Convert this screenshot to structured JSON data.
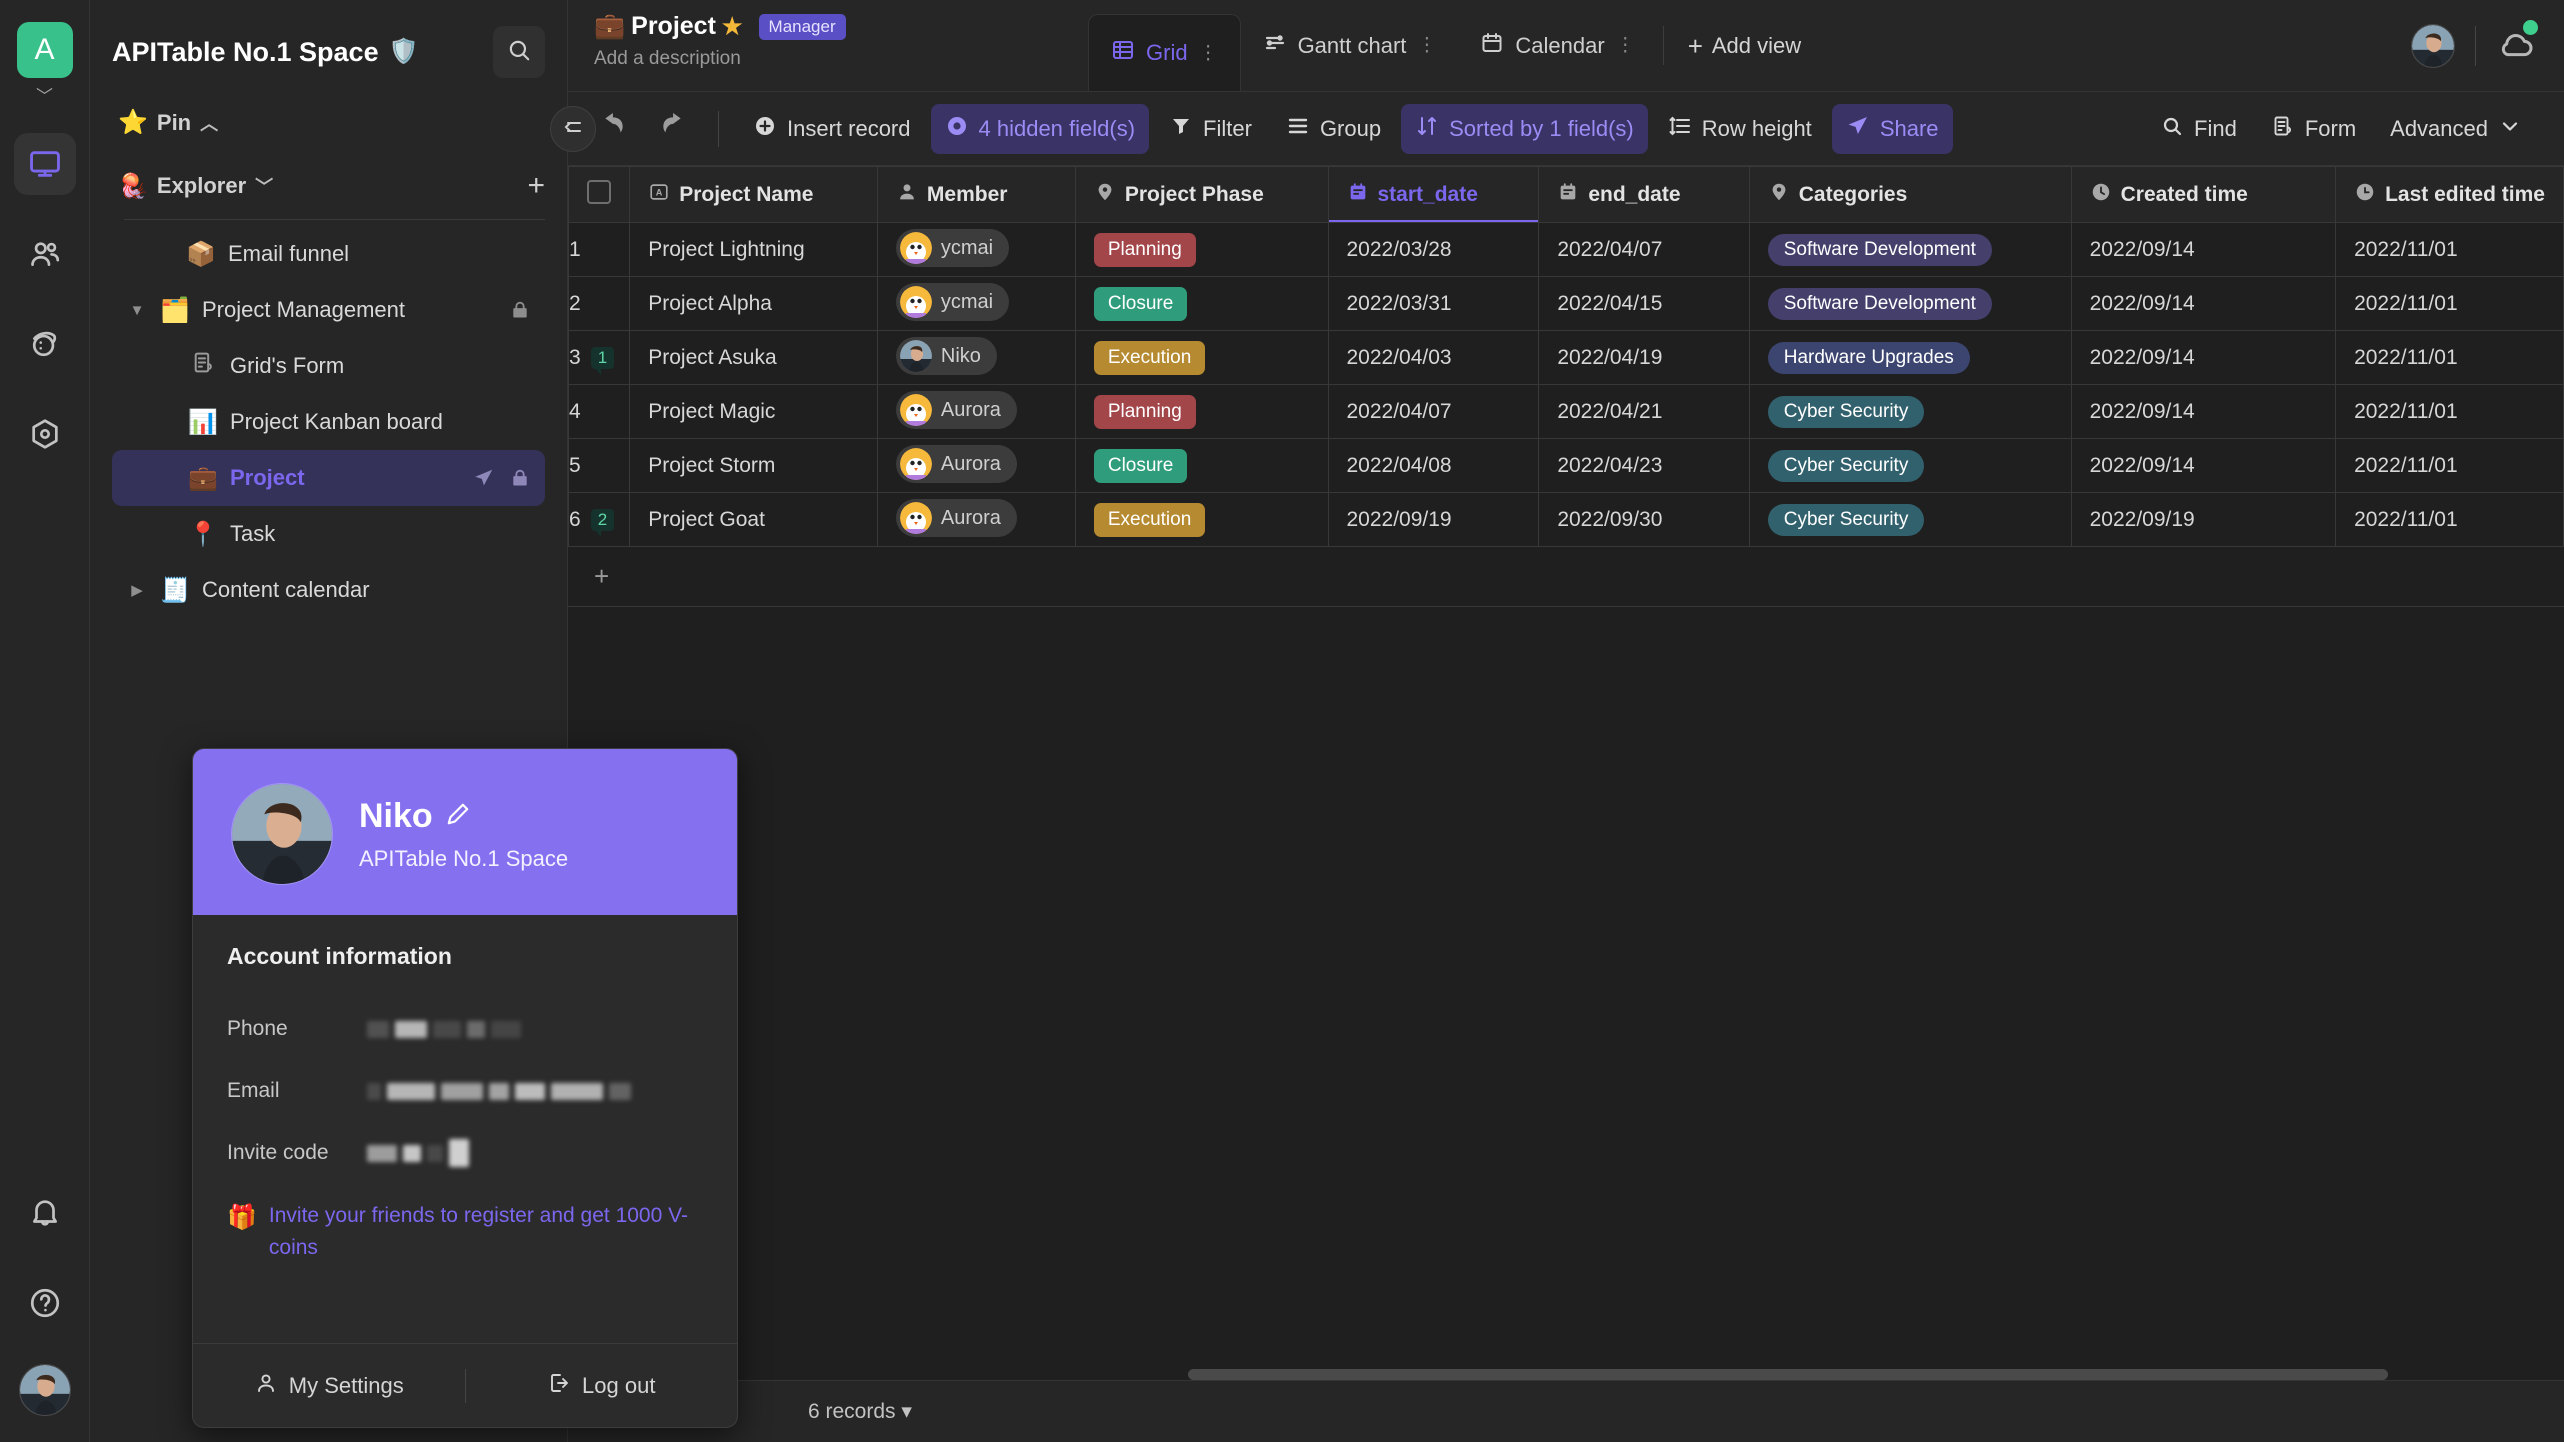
{
  "space": {
    "logo_letter": "A",
    "title": "APITable No.1 Space",
    "badge_icon": "🛡️",
    "search_icon": "search-icon"
  },
  "rail": {
    "items": [
      {
        "name": "workbench",
        "icon": "monitor-icon",
        "active": true
      },
      {
        "name": "members",
        "icon": "people-icon",
        "active": false
      },
      {
        "name": "template",
        "icon": "planet-icon",
        "active": false
      },
      {
        "name": "automation",
        "icon": "hexagon-target-icon",
        "active": false
      }
    ],
    "bottom": [
      {
        "name": "notifications",
        "icon": "bell-icon"
      },
      {
        "name": "help",
        "icon": "question-circle-icon"
      }
    ]
  },
  "sidebar": {
    "pin": {
      "label": "Pin",
      "emoji": "⭐",
      "caret": "︿"
    },
    "explorer": {
      "label": "Explorer",
      "emoji": "🪼",
      "caret": "﹀",
      "add": "+"
    },
    "tree": [
      {
        "label": "Email funnel",
        "emoji": "📦",
        "indent": 1,
        "twisty": "",
        "selected": false,
        "lock": false,
        "share": false
      },
      {
        "label": "Project Management",
        "emoji": "🗂️",
        "indent": 0,
        "twisty": "▼",
        "selected": false,
        "lock": true,
        "share": false
      },
      {
        "label": "Grid's Form",
        "emoji": "",
        "indent": 2,
        "twisty": "",
        "selected": false,
        "lock": false,
        "share": false,
        "icon": "form-icon"
      },
      {
        "label": "Project Kanban board",
        "emoji": "📊",
        "indent": 2,
        "twisty": "",
        "selected": false,
        "lock": false,
        "share": false
      },
      {
        "label": "Project",
        "emoji": "💼",
        "indent": 2,
        "twisty": "",
        "selected": true,
        "lock": true,
        "share": true
      },
      {
        "label": "Task",
        "emoji": "📍",
        "indent": 2,
        "twisty": "",
        "selected": false,
        "lock": false,
        "share": false
      },
      {
        "label": "Content calendar",
        "emoji": "🧾",
        "indent": 0,
        "twisty": "▶",
        "selected": false,
        "lock": false,
        "share": false
      }
    ]
  },
  "account": {
    "name": "Niko",
    "edit_icon": "pencil-icon",
    "space_name": "APITable No.1 Space",
    "section_title": "Account information",
    "rows": [
      {
        "label": "Phone",
        "value": "",
        "masked": true
      },
      {
        "label": "Email",
        "value": "",
        "masked": true
      },
      {
        "label": "Invite code",
        "value": "",
        "masked": true
      }
    ],
    "invite_text": "Invite your friends to register and get 1000 V-coins",
    "invite_emoji": "🎁",
    "settings_label": "My Settings",
    "logout_label": "Log out"
  },
  "node": {
    "emoji": "💼",
    "title": "Project",
    "star": "★",
    "role": "Manager",
    "description": "Add a description"
  },
  "views": {
    "tabs": [
      {
        "label": "Grid",
        "icon": "grid-icon",
        "active": true,
        "more": "⋮"
      },
      {
        "label": "Gantt chart",
        "icon": "gantt-icon",
        "active": false,
        "more": "⋮"
      },
      {
        "label": "Calendar",
        "icon": "calendar-icon",
        "active": false,
        "more": "⋮"
      }
    ],
    "add_view": "Add view"
  },
  "toolbar": {
    "undo": "undo-icon",
    "redo": "redo-icon",
    "insert_record": "Insert record",
    "hidden_fields": "4 hidden field(s)",
    "filter": "Filter",
    "group": "Group",
    "sorted": "Sorted by 1 field(s)",
    "row_height": "Row height",
    "share": "Share",
    "find": "Find",
    "form": "Form",
    "advanced": "Advanced"
  },
  "grid": {
    "columns": [
      {
        "label": "Project Name",
        "icon": "text-field-icon",
        "sorted": false
      },
      {
        "label": "Member",
        "icon": "member-icon",
        "sorted": false
      },
      {
        "label": "Project Phase",
        "icon": "single-select-icon",
        "sorted": false
      },
      {
        "label": "start_date",
        "icon": "date-icon",
        "sorted": true
      },
      {
        "label": "end_date",
        "icon": "date-icon",
        "sorted": false
      },
      {
        "label": "Categories",
        "icon": "single-select-icon",
        "sorted": false
      },
      {
        "label": "Created time",
        "icon": "clock-icon",
        "sorted": false
      },
      {
        "label": "Last edited time",
        "icon": "clock-edit-icon",
        "sorted": false
      }
    ],
    "rows": [
      {
        "no": "1",
        "comments": "",
        "name": "Project Lightning",
        "member": "ycmai",
        "member_avatar": "chick",
        "phase": "Planning",
        "phase_color": "#a3464a",
        "start_date": "2022/03/28",
        "end_date": "2022/04/07",
        "category": "Software Development",
        "category_color": "#443f6b",
        "created": "2022/09/14",
        "edited": "2022/11/01"
      },
      {
        "no": "2",
        "comments": "",
        "name": "Project Alpha",
        "member": "ycmai",
        "member_avatar": "chick",
        "phase": "Closure",
        "phase_color": "#2f9c7b",
        "start_date": "2022/03/31",
        "end_date": "2022/04/15",
        "category": "Software Development",
        "category_color": "#443f6b",
        "created": "2022/09/14",
        "edited": "2022/11/01"
      },
      {
        "no": "3",
        "comments": "1",
        "name": "Project Asuka",
        "member": "Niko",
        "member_avatar": "photo",
        "phase": "Execution",
        "phase_color": "#b58a30",
        "start_date": "2022/04/03",
        "end_date": "2022/04/19",
        "category": "Hardware Upgrades",
        "category_color": "#3c4570",
        "created": "2022/09/14",
        "edited": "2022/11/01"
      },
      {
        "no": "4",
        "comments": "",
        "name": "Project Magic",
        "member": "Aurora",
        "member_avatar": "chick",
        "phase": "Planning",
        "phase_color": "#a3464a",
        "start_date": "2022/04/07",
        "end_date": "2022/04/21",
        "category": "Cyber Security",
        "category_color": "#32616e",
        "created": "2022/09/14",
        "edited": "2022/11/01"
      },
      {
        "no": "5",
        "comments": "",
        "name": "Project Storm",
        "member": "Aurora",
        "member_avatar": "chick",
        "phase": "Closure",
        "phase_color": "#2f9c7b",
        "start_date": "2022/04/08",
        "end_date": "2022/04/23",
        "category": "Cyber Security",
        "category_color": "#32616e",
        "created": "2022/09/14",
        "edited": "2022/11/01"
      },
      {
        "no": "6",
        "comments": "2",
        "name": "Project Goat",
        "member": "Aurora",
        "member_avatar": "chick",
        "phase": "Execution",
        "phase_color": "#b58a30",
        "start_date": "2022/09/19",
        "end_date": "2022/09/30",
        "category": "Cyber Security",
        "category_color": "#32616e",
        "created": "2022/09/19",
        "edited": "2022/11/01"
      }
    ],
    "add_row": "+"
  },
  "status": {
    "records": "6 records ▾"
  },
  "colors": {
    "accent": "#7b67ee",
    "accent_bg": "#393366",
    "hero": "#8571f0",
    "logo": "#39c18b",
    "online": "#3ecf8e"
  }
}
